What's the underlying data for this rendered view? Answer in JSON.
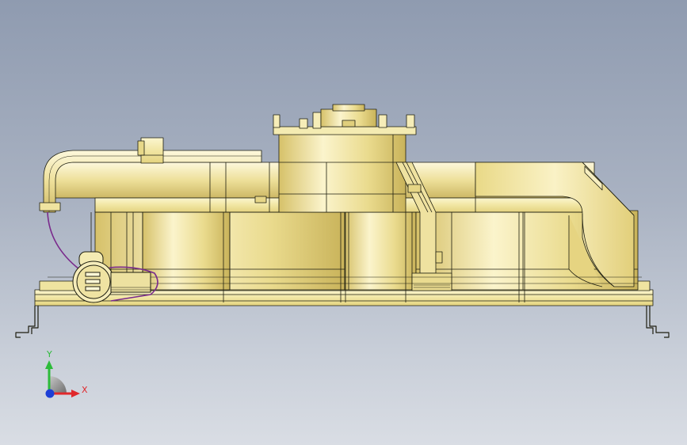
{
  "viewport": {
    "background_top": "#8f9bb0",
    "background_bottom": "#d9dde4"
  },
  "model": {
    "description_icon": "fan-shroud-assembly-icon",
    "body_color": "#f3e8a6",
    "shade_color": "#d8c36e",
    "edge_color": "#1e1e10",
    "wire_color": "#7a2a8c"
  },
  "triad": {
    "x_label": "X",
    "y_label": "Y",
    "x_color": "#e0282b",
    "y_color": "#2dbb3a",
    "z_color": "#1d3fd6"
  }
}
